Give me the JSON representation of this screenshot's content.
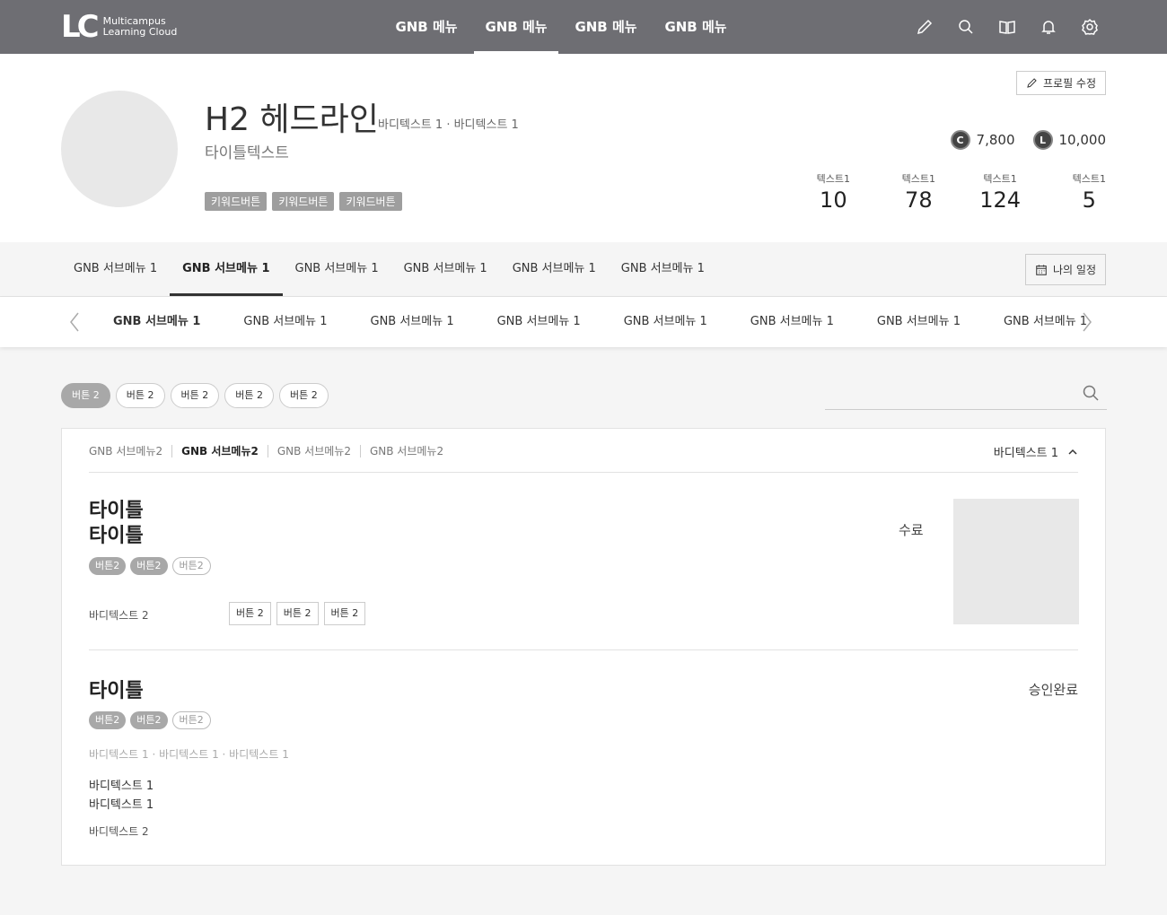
{
  "gnb": {
    "logo_mark": "LC",
    "logo_line1": "Multicampus",
    "logo_line2": "Learning Cloud",
    "menu": [
      "GNB 메뉴",
      "GNB 메뉴",
      "GNB 메뉴",
      "GNB 메뉴"
    ],
    "active_index": 1,
    "icons": [
      "pencil-icon",
      "search-icon",
      "book-icon",
      "bell-icon",
      "gear-icon"
    ]
  },
  "profile": {
    "name": "H2 헤드라인",
    "name_sub": "바디텍스트 1 · 바디텍스트 1",
    "title_text": "타이틀텍스트",
    "keywords": [
      "키워드버튼",
      "키워드버튼",
      "키워드버튼"
    ],
    "edit_label": "프로필 수정",
    "points": [
      {
        "badge": "C",
        "value": "7,800"
      },
      {
        "badge": "L",
        "value": "10,000"
      }
    ],
    "stats": [
      {
        "label": "텍스트1",
        "value": "10"
      },
      {
        "label": "텍스트1",
        "value": "78"
      },
      {
        "label": "텍스트1",
        "value": "124"
      },
      {
        "label": "텍스트1",
        "value": "5"
      }
    ]
  },
  "subnav": {
    "items": [
      "GNB 서브메뉴 1",
      "GNB 서브메뉴 1",
      "GNB 서브메뉴 1",
      "GNB 서브메뉴 1",
      "GNB 서브메뉴 1",
      "GNB 서브메뉴 1"
    ],
    "active_index": 1,
    "schedule_label": "나의 일정"
  },
  "subnav2": {
    "items": [
      "GNB 서브메뉴 1",
      "GNB 서브메뉴 1",
      "GNB 서브메뉴 1",
      "GNB 서브메뉴 1",
      "GNB 서브메뉴 1",
      "GNB 서브메뉴 1",
      "GNB 서브메뉴 1",
      "GNB 서브메뉴 1"
    ],
    "active_index": 0
  },
  "filters": {
    "chips": [
      "버튼 2",
      "버튼 2",
      "버튼 2",
      "버튼 2",
      "버튼 2"
    ],
    "active_index": 0,
    "search_placeholder": ""
  },
  "panel": {
    "tabs": [
      "GNB 서브메뉴2",
      "GNB 서브메뉴2",
      "GNB 서브메뉴2",
      "GNB 서브메뉴2"
    ],
    "active_tab": 1,
    "sort_label": "바디텍스트 1",
    "card1": {
      "title_line1": "타이틀",
      "title_line2": "타이틀",
      "chips": [
        "버튼2",
        "버튼2",
        "버튼2"
      ],
      "body2": "바디텍스트 2",
      "buttons": [
        "버튼 2",
        "버튼 2",
        "버튼 2"
      ],
      "status": "수료"
    },
    "card2": {
      "title": "타이틀",
      "chips": [
        "버튼2",
        "버튼2",
        "버튼2"
      ],
      "meta": "바디텍스트 1 · 바디텍스트 1 · 바디텍스트 1",
      "body1_line1": "바디텍스트 1",
      "body1_line2": "바디텍스트 1",
      "body2": "바디텍스트 2",
      "status": "승인완료"
    }
  }
}
